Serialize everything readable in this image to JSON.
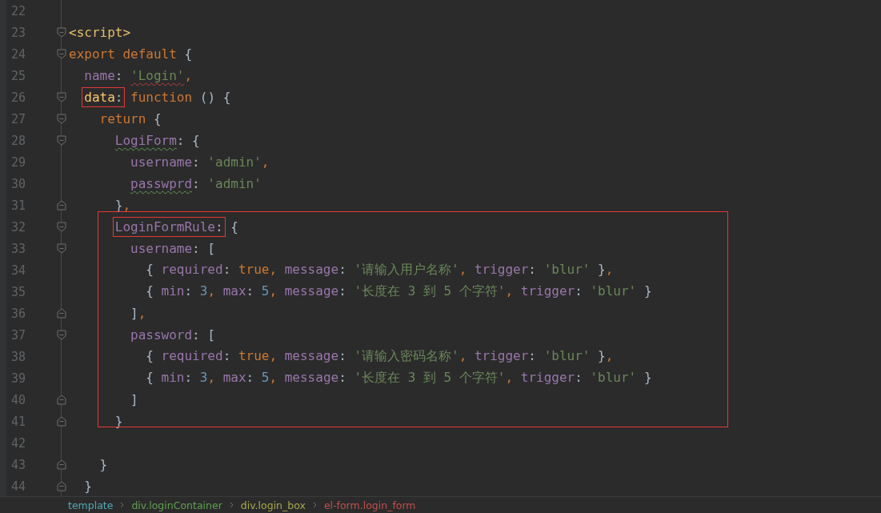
{
  "editor": {
    "lines": [
      {
        "number": "22",
        "fold_start": false,
        "fold_end": false
      },
      {
        "number": "23",
        "fold_start": true,
        "fold_end": false,
        "tokens": [
          {
            "kind": "tag",
            "text": "<script>"
          }
        ]
      },
      {
        "number": "24",
        "fold_start": true,
        "fold_end": false,
        "tokens": [
          {
            "kind": "keyword",
            "text": "export default "
          },
          {
            "kind": "plain",
            "text": "{"
          }
        ],
        "children": [
          {
            "number": "25",
            "fold_start": false,
            "fold_end": false,
            "tokens": [
              {
                "kind": "prop",
                "text": "name"
              },
              {
                "kind": "plain",
                "text": ": "
              },
              {
                "kind": "string",
                "text": "'Login'",
                "error": true
              },
              {
                "kind": "keyword",
                "text": ","
              }
            ]
          },
          {
            "number": "26",
            "fold_start": true,
            "fold_end": false,
            "tokens": [
              {
                "boxed": true,
                "tokens": [
                  {
                    "kind": "field",
                    "text": "data"
                  },
                  {
                    "kind": "plain",
                    "text": ":"
                  }
                ]
              },
              {
                "kind": "keyword",
                "text": " function"
              },
              {
                "kind": "plain",
                "text": " () {"
              }
            ],
            "children": [
              {
                "number": "27",
                "fold_start": true,
                "fold_end": false,
                "tokens": [
                  {
                    "kind": "keyword",
                    "text": "return"
                  },
                  {
                    "kind": "plain",
                    "text": " {"
                  }
                ],
                "children": [
                  {
                    "number": "28",
                    "fold_start": true,
                    "fold_end": false,
                    "tokens": [
                      {
                        "kind": "prop",
                        "text": "LogiForm",
                        "typo": true
                      },
                      {
                        "kind": "plain",
                        "text": ": {"
                      }
                    ],
                    "children": [
                      {
                        "number": "29",
                        "fold_start": false,
                        "fold_end": false,
                        "tokens": [
                          {
                            "kind": "prop",
                            "text": "username"
                          },
                          {
                            "kind": "plain",
                            "text": ": "
                          },
                          {
                            "kind": "string",
                            "text": "'admin'"
                          },
                          {
                            "kind": "keyword",
                            "text": ","
                          }
                        ]
                      },
                      {
                        "number": "30",
                        "fold_start": false,
                        "fold_end": false,
                        "tokens": [
                          {
                            "kind": "prop",
                            "text": "passwprd",
                            "typo": true
                          },
                          {
                            "kind": "plain",
                            "text": ": "
                          },
                          {
                            "kind": "string",
                            "text": "'admin'"
                          }
                        ]
                      }
                    ]
                  },
                  {
                    "number": "31",
                    "fold_start": false,
                    "fold_end": true,
                    "tokens": [
                      {
                        "kind": "plain",
                        "text": "}"
                      },
                      {
                        "kind": "keyword",
                        "text": ","
                      }
                    ]
                  },
                  {
                    "number": "32",
                    "fold_start": true,
                    "fold_end": false,
                    "framed": true,
                    "tokens": [
                      {
                        "boxed": true,
                        "tokens": [
                          {
                            "kind": "prop",
                            "text": "LoginFormRule"
                          },
                          {
                            "kind": "plain",
                            "text": ":"
                          }
                        ]
                      },
                      {
                        "kind": "plain",
                        "text": " {"
                      }
                    ],
                    "children": [
                      {
                        "number": "33",
                        "fold_start": true,
                        "fold_end": false,
                        "tokens": [
                          {
                            "kind": "prop",
                            "text": "username"
                          },
                          {
                            "kind": "plain",
                            "text": ": ["
                          }
                        ],
                        "children": [
                          {
                            "number": "34",
                            "fold_start": false,
                            "fold_end": false,
                            "tokens": [
                              {
                                "kind": "plain",
                                "text": "{ "
                              },
                              {
                                "kind": "prop",
                                "text": "required"
                              },
                              {
                                "kind": "plain",
                                "text": ": "
                              },
                              {
                                "kind": "keyword",
                                "text": "true, "
                              },
                              {
                                "kind": "prop",
                                "text": "message"
                              },
                              {
                                "kind": "plain",
                                "text": ": "
                              },
                              {
                                "kind": "string",
                                "text": "'请输入用户名称'"
                              },
                              {
                                "kind": "keyword",
                                "text": ", "
                              },
                              {
                                "kind": "prop",
                                "text": "trigger"
                              },
                              {
                                "kind": "plain",
                                "text": ": "
                              },
                              {
                                "kind": "string",
                                "text": "'blur'"
                              },
                              {
                                "kind": "plain",
                                "text": " }"
                              },
                              {
                                "kind": "keyword",
                                "text": ","
                              }
                            ]
                          },
                          {
                            "number": "35",
                            "fold_start": false,
                            "fold_end": false,
                            "tokens": [
                              {
                                "kind": "plain",
                                "text": "{ "
                              },
                              {
                                "kind": "prop",
                                "text": "min"
                              },
                              {
                                "kind": "plain",
                                "text": ": "
                              },
                              {
                                "kind": "number",
                                "text": "3"
                              },
                              {
                                "kind": "keyword",
                                "text": ", "
                              },
                              {
                                "kind": "prop",
                                "text": "max"
                              },
                              {
                                "kind": "plain",
                                "text": ": "
                              },
                              {
                                "kind": "number",
                                "text": "5"
                              },
                              {
                                "kind": "keyword",
                                "text": ", "
                              },
                              {
                                "kind": "prop",
                                "text": "message"
                              },
                              {
                                "kind": "plain",
                                "text": ": "
                              },
                              {
                                "kind": "string",
                                "text": "'长度在 3 到 5 个字符'"
                              },
                              {
                                "kind": "keyword",
                                "text": ", "
                              },
                              {
                                "kind": "prop",
                                "text": "trigger"
                              },
                              {
                                "kind": "plain",
                                "text": ": "
                              },
                              {
                                "kind": "string",
                                "text": "'blur'"
                              },
                              {
                                "kind": "plain",
                                "text": " }"
                              }
                            ]
                          }
                        ]
                      },
                      {
                        "number": "36",
                        "fold_start": false,
                        "fold_end": true,
                        "tokens": [
                          {
                            "kind": "plain",
                            "text": "]"
                          },
                          {
                            "kind": "keyword",
                            "text": ","
                          }
                        ]
                      },
                      {
                        "number": "37",
                        "fold_start": true,
                        "fold_end": false,
                        "tokens": [
                          {
                            "kind": "prop",
                            "text": "password"
                          },
                          {
                            "kind": "plain",
                            "text": ": ["
                          }
                        ],
                        "children": [
                          {
                            "number": "38",
                            "fold_start": false,
                            "fold_end": false,
                            "tokens": [
                              {
                                "kind": "plain",
                                "text": "{ "
                              },
                              {
                                "kind": "prop",
                                "text": "required"
                              },
                              {
                                "kind": "plain",
                                "text": ": "
                              },
                              {
                                "kind": "keyword",
                                "text": "true, "
                              },
                              {
                                "kind": "prop",
                                "text": "message"
                              },
                              {
                                "kind": "plain",
                                "text": ": "
                              },
                              {
                                "kind": "string",
                                "text": "'请输入密码名称'"
                              },
                              {
                                "kind": "keyword",
                                "text": ", "
                              },
                              {
                                "kind": "prop",
                                "text": "trigger"
                              },
                              {
                                "kind": "plain",
                                "text": ": "
                              },
                              {
                                "kind": "string",
                                "text": "'blur'"
                              },
                              {
                                "kind": "plain",
                                "text": " }"
                              },
                              {
                                "kind": "keyword",
                                "text": ","
                              }
                            ]
                          },
                          {
                            "number": "39",
                            "fold_start": false,
                            "fold_end": false,
                            "tokens": [
                              {
                                "kind": "plain",
                                "text": "{ "
                              },
                              {
                                "kind": "prop",
                                "text": "min"
                              },
                              {
                                "kind": "plain",
                                "text": ": "
                              },
                              {
                                "kind": "number",
                                "text": "3"
                              },
                              {
                                "kind": "keyword",
                                "text": ", "
                              },
                              {
                                "kind": "prop",
                                "text": "max"
                              },
                              {
                                "kind": "plain",
                                "text": ": "
                              },
                              {
                                "kind": "number",
                                "text": "5"
                              },
                              {
                                "kind": "keyword",
                                "text": ", "
                              },
                              {
                                "kind": "prop",
                                "text": "message"
                              },
                              {
                                "kind": "plain",
                                "text": ": "
                              },
                              {
                                "kind": "string",
                                "text": "'长度在 3 到 5 个字符'"
                              },
                              {
                                "kind": "keyword",
                                "text": ", "
                              },
                              {
                                "kind": "prop",
                                "text": "trigger"
                              },
                              {
                                "kind": "plain",
                                "text": ": "
                              },
                              {
                                "kind": "string",
                                "text": "'blur'"
                              },
                              {
                                "kind": "plain",
                                "text": " }"
                              }
                            ]
                          }
                        ]
                      },
                      {
                        "number": "40",
                        "fold_start": false,
                        "fold_end": true,
                        "tokens": [
                          {
                            "kind": "plain",
                            "text": "]"
                          }
                        ]
                      }
                    ]
                  },
                  {
                    "number": "41",
                    "fold_start": false,
                    "fold_end": true,
                    "tokens": [
                      {
                        "kind": "plain",
                        "text": "}"
                      }
                    ]
                  },
                  {
                    "number": "42",
                    "fold_start": false,
                    "fold_end": false
                  }
                ]
              },
              {
                "number": "43",
                "fold_start": false,
                "fold_end": true,
                "tokens": [
                  {
                    "kind": "plain",
                    "text": "}"
                  }
                ]
              }
            ]
          },
          {
            "number": "44",
            "fold_start": false,
            "fold_end": true,
            "tokens": [
              {
                "kind": "plain",
                "text": "}"
              }
            ]
          }
        ]
      }
    ]
  },
  "breadcrumbs": [
    {
      "label": "template",
      "color": "#4fa9b5"
    },
    {
      "label": "div.loginContainer",
      "color": "#5fa04e"
    },
    {
      "label": "div.login_box",
      "color": "#a8a84a"
    },
    {
      "label": "el-form.login_form",
      "color": "#c0504d"
    }
  ]
}
